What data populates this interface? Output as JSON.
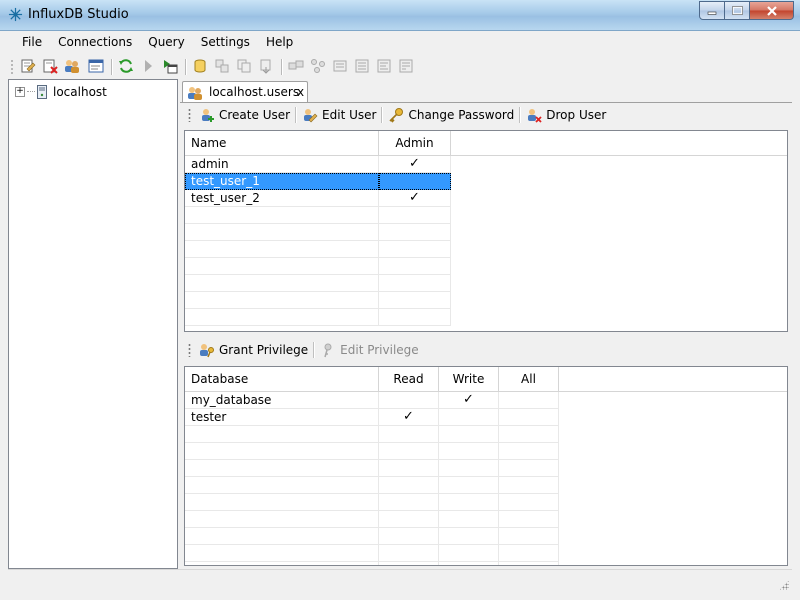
{
  "window": {
    "title": "InfluxDB Studio"
  },
  "menu": [
    "File",
    "Connections",
    "Query",
    "Settings",
    "Help"
  ],
  "toolbar_icons": [
    "new-connection-icon",
    "delete-connection-icon",
    "manage-users-icon",
    "connection-properties-icon",
    "refresh-icon",
    "run-query-icon",
    "new-query-icon",
    "create-database-icon",
    "backfill-icon",
    "copy-icon",
    "export-icon",
    "show-diagnostics-icon",
    "show-series-icon",
    "show-measurements-icon",
    "show-tag-keys-icon",
    "show-tag-values-icon",
    "show-field-keys-icon"
  ],
  "tree": {
    "server": "localhost"
  },
  "tab": {
    "label": "localhost.users",
    "close": "x"
  },
  "users_toolbar": {
    "create_user": "Create User",
    "edit_user": "Edit User",
    "change_password": "Change Password",
    "drop_user": "Drop User"
  },
  "users_grid": {
    "columns": [
      "Name",
      "Admin"
    ],
    "rows": [
      {
        "name": "admin",
        "admin": "✓"
      },
      {
        "name": "test_user_1",
        "admin": ""
      },
      {
        "name": "test_user_2",
        "admin": "✓"
      }
    ],
    "selected_index": 1
  },
  "privileges_toolbar": {
    "grant_privilege": "Grant Privilege",
    "edit_privilege": "Edit Privilege"
  },
  "privileges_grid": {
    "columns": [
      "Database",
      "Read",
      "Write",
      "All"
    ],
    "rows": [
      {
        "database": "my_database",
        "read": "",
        "write": "✓",
        "all": ""
      },
      {
        "database": "tester",
        "read": "✓",
        "write": "",
        "all": ""
      }
    ]
  },
  "colors": {
    "selection": "#3399ff",
    "border": "#828790"
  }
}
